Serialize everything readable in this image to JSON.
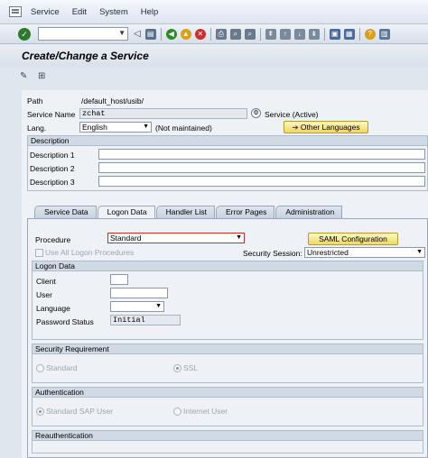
{
  "menu": {
    "items": [
      "Service",
      "Edit",
      "System",
      "Help"
    ]
  },
  "toolbar": {
    "command_value": ""
  },
  "title": "Create/Change a Service",
  "header": {
    "path_label": "Path",
    "path_value": "/default_host/usib/",
    "service_label": "Service Name",
    "service_value": "zchat",
    "service_status": "Service (Active)",
    "lang_label": "Lang.",
    "lang_value": "English",
    "lang_note": "(Not maintained)",
    "other_languages": "Other Languages"
  },
  "description": {
    "header": "Description",
    "labels": [
      "Description 1",
      "Description 2",
      "Description 3"
    ]
  },
  "tabs": [
    "Service Data",
    "Logon Data",
    "Handler List",
    "Error Pages",
    "Administration"
  ],
  "logon": {
    "procedure_label": "Procedure",
    "procedure_value": "Standard",
    "saml_button": "SAML Configuration",
    "use_all_label": "Use All Logon Procedures",
    "security_session_label": "Security Session:",
    "security_session_value": "Unrestricted",
    "logon_data_header": "Logon Data",
    "client_label": "Client",
    "user_label": "User",
    "language_label": "Language",
    "password_status_label": "Password Status",
    "password_status_value": "Initial",
    "security_req_header": "Security Requirement",
    "sr_standard": "Standard",
    "sr_ssl": "SSL",
    "auth_header": "Authentication",
    "auth_standard": "Standard SAP User",
    "auth_internet": "Internet User",
    "reauth_header": "Reauthentication"
  }
}
